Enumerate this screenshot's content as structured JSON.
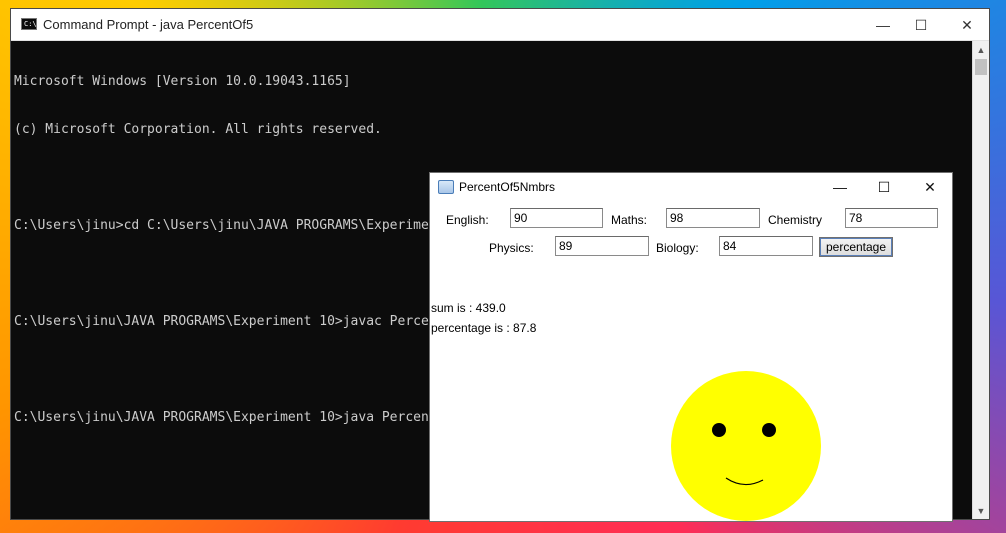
{
  "console": {
    "title": "Command Prompt - java  PercentOf5",
    "lines": [
      "Microsoft Windows [Version 10.0.19043.1165]",
      "(c) Microsoft Corporation. All rights reserved.",
      "",
      "C:\\Users\\jinu>cd C:\\Users\\jinu\\JAVA PROGRAMS\\Experiment 10",
      "",
      "C:\\Users\\jinu\\JAVA PROGRAMS\\Experiment 10>javac PercentOf5.java",
      "",
      "C:\\Users\\jinu\\JAVA PROGRAMS\\Experiment 10>java PercentOf5"
    ],
    "controls": {
      "minimize": "—",
      "maximize": "☐",
      "close": "✕"
    }
  },
  "applet": {
    "title": "PercentOf5Nmbrs",
    "controls": {
      "minimize": "—",
      "maximize": "☐",
      "close": "✕"
    },
    "fields": {
      "english": {
        "label": "English:",
        "value": "90"
      },
      "maths": {
        "label": "Maths:",
        "value": "98"
      },
      "chemistry": {
        "label": "Chemistry",
        "value": "78"
      },
      "physics": {
        "label": "Physics:",
        "value": "89"
      },
      "biology": {
        "label": "Biology:",
        "value": "84"
      }
    },
    "button_label": "percentage",
    "output": {
      "sum": "sum is : 439.0",
      "percentage": "percentage  is : 87.8"
    },
    "face_color": "#ffff00"
  }
}
